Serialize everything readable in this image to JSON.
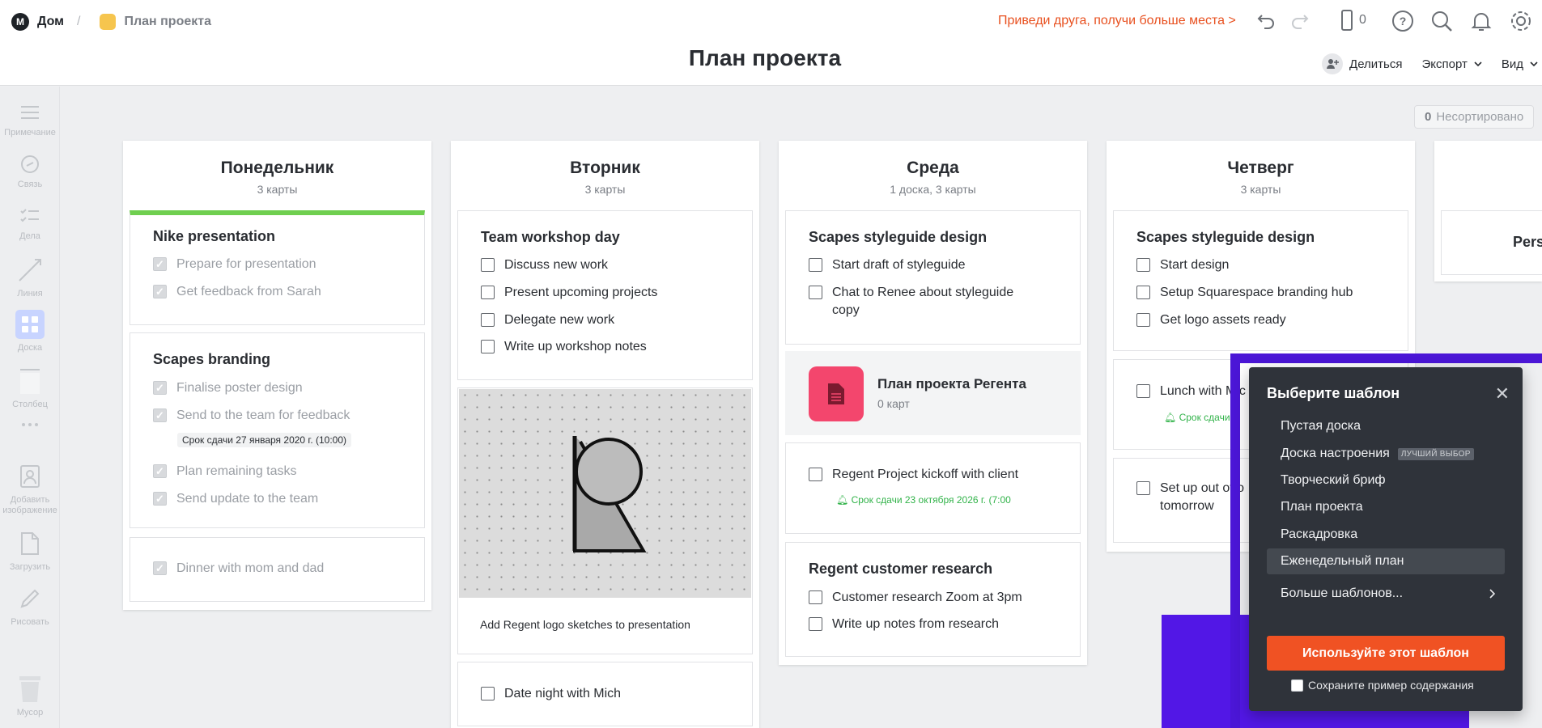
{
  "header": {
    "logo_text": "M",
    "home": "Дом",
    "separator": "/",
    "current": "План проекта",
    "promo": "Приведи друга, получи больше места >",
    "device_count": "0",
    "title": "План проекта",
    "share": "Делиться",
    "export": "Экспорт",
    "view": "Вид"
  },
  "sidebar": {
    "items": [
      {
        "label": "Примечание",
        "icon": "note-icon"
      },
      {
        "label": "Связь",
        "icon": "link-icon"
      },
      {
        "label": "Дела",
        "icon": "todo-icon"
      },
      {
        "label": "Линия",
        "icon": "line-icon"
      },
      {
        "label": "Доска",
        "icon": "board-icon"
      },
      {
        "label": "Столбец",
        "icon": "column-icon"
      },
      {
        "label": "Добавить изображение",
        "icon": "image-icon"
      },
      {
        "label": "Загрузить",
        "icon": "upload-icon"
      },
      {
        "label": "Рисовать",
        "icon": "draw-icon"
      },
      {
        "label": "Мусор",
        "icon": "trash-icon"
      }
    ]
  },
  "unsorted": {
    "count": "0",
    "label": "Несортировано"
  },
  "columns": [
    {
      "title": "Понедельник",
      "count": "3 карты",
      "cards": [
        {
          "title": "Nike presentation",
          "tasks": [
            "Prepare for presentation",
            "Get feedback from Sarah"
          ]
        },
        {
          "title": "Scapes branding",
          "tasks": [
            "Finalise poster design",
            "Send to the team for feedback",
            "Plan remaining tasks",
            "Send update to the team"
          ],
          "due": "Срок сдачи 27 января 2020 г. (10:00)"
        },
        {
          "tasks": [
            "Dinner with mom and dad"
          ]
        }
      ]
    },
    {
      "title": "Вторник",
      "count": "3 карты",
      "cards": [
        {
          "title": "Team workshop day",
          "tasks": [
            "Discuss new work",
            "Present upcoming projects",
            "Delegate new work",
            "Write up workshop notes"
          ]
        },
        {
          "caption": "Add Regent logo sketches to presentation"
        },
        {
          "tasks": [
            "Date night with Mich"
          ]
        }
      ]
    },
    {
      "title": "Среда",
      "count": "1 доска, 3 карты",
      "cards": [
        {
          "title": "Scapes styleguide design",
          "tasks": [
            "Start draft of styleguide",
            "Chat to Renee about styleguide copy"
          ]
        },
        {
          "board_title": "План проекта Регента",
          "board_count": "0 карт"
        },
        {
          "tasks": [
            "Regent Project kickoff with client"
          ],
          "due": "Срок сдачи 23 октября 2026 г. (7:00"
        },
        {
          "title": "Regent customer research",
          "tasks": [
            "Customer research Zoom at 3pm",
            "Write up notes from research"
          ]
        }
      ]
    },
    {
      "title": "Четверг",
      "count": "3 карты",
      "cards": [
        {
          "title": "Scapes styleguide design",
          "tasks": [
            "Start design",
            "Setup Squarespace branding hub",
            "Get logo assets ready"
          ]
        },
        {
          "tasks": [
            "Lunch with Mic"
          ],
          "due": "Срок сдачи"
        },
        {
          "tasks": [
            "Set up out of o",
            "tomorrow"
          ]
        }
      ]
    },
    {
      "partial_card": "Pers"
    }
  ],
  "template_modal": {
    "title": "Выберите шаблон",
    "options": [
      "Пустая доска",
      "Доска настроения",
      "Творческий бриф",
      "План проекта",
      "Раскадровка",
      "Еженедельный план",
      "Больше шаблонов..."
    ],
    "best_badge": "ЛУЧШИЙ ВЫБОР",
    "selected": "Еженедельный план",
    "button": "Используйте этот шаблон",
    "keep_sample": "Сохраните пример содержания"
  },
  "colors": {
    "accent": "#f05223",
    "highlight_frame": "#4b16d6",
    "done_bar": "#6fcf4f",
    "board_icon": "#f3466d"
  }
}
